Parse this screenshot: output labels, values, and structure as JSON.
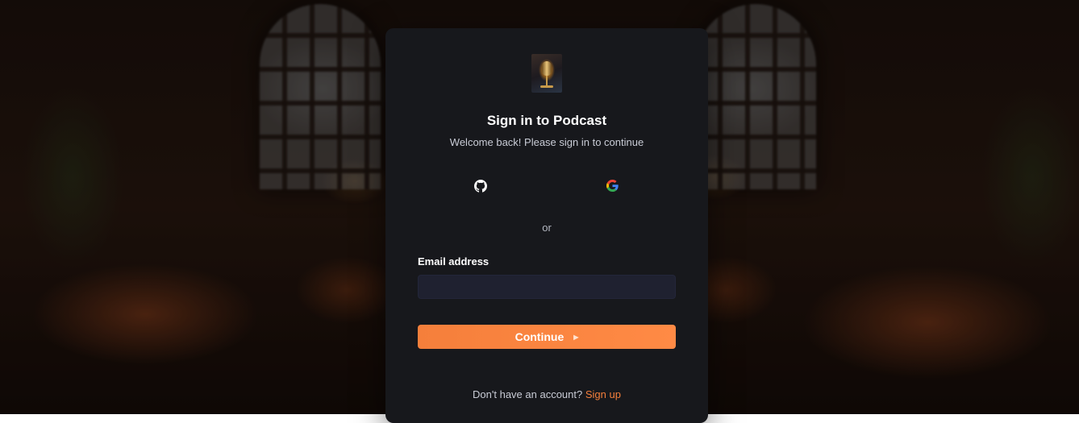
{
  "header": {
    "title": "Sign in to Podcast",
    "subtitle": "Welcome back! Please sign in to continue"
  },
  "social": {
    "github_icon": "github-icon",
    "google_icon": "google-icon"
  },
  "divider": {
    "text": "or"
  },
  "form": {
    "email_label": "Email address",
    "email_value": "",
    "continue_label": "Continue"
  },
  "footer": {
    "prompt": "Don't have an account?",
    "signup_label": "Sign up"
  },
  "colors": {
    "accent": "#f57f3b",
    "card_bg": "#17181c",
    "input_bg": "#1f2130"
  }
}
